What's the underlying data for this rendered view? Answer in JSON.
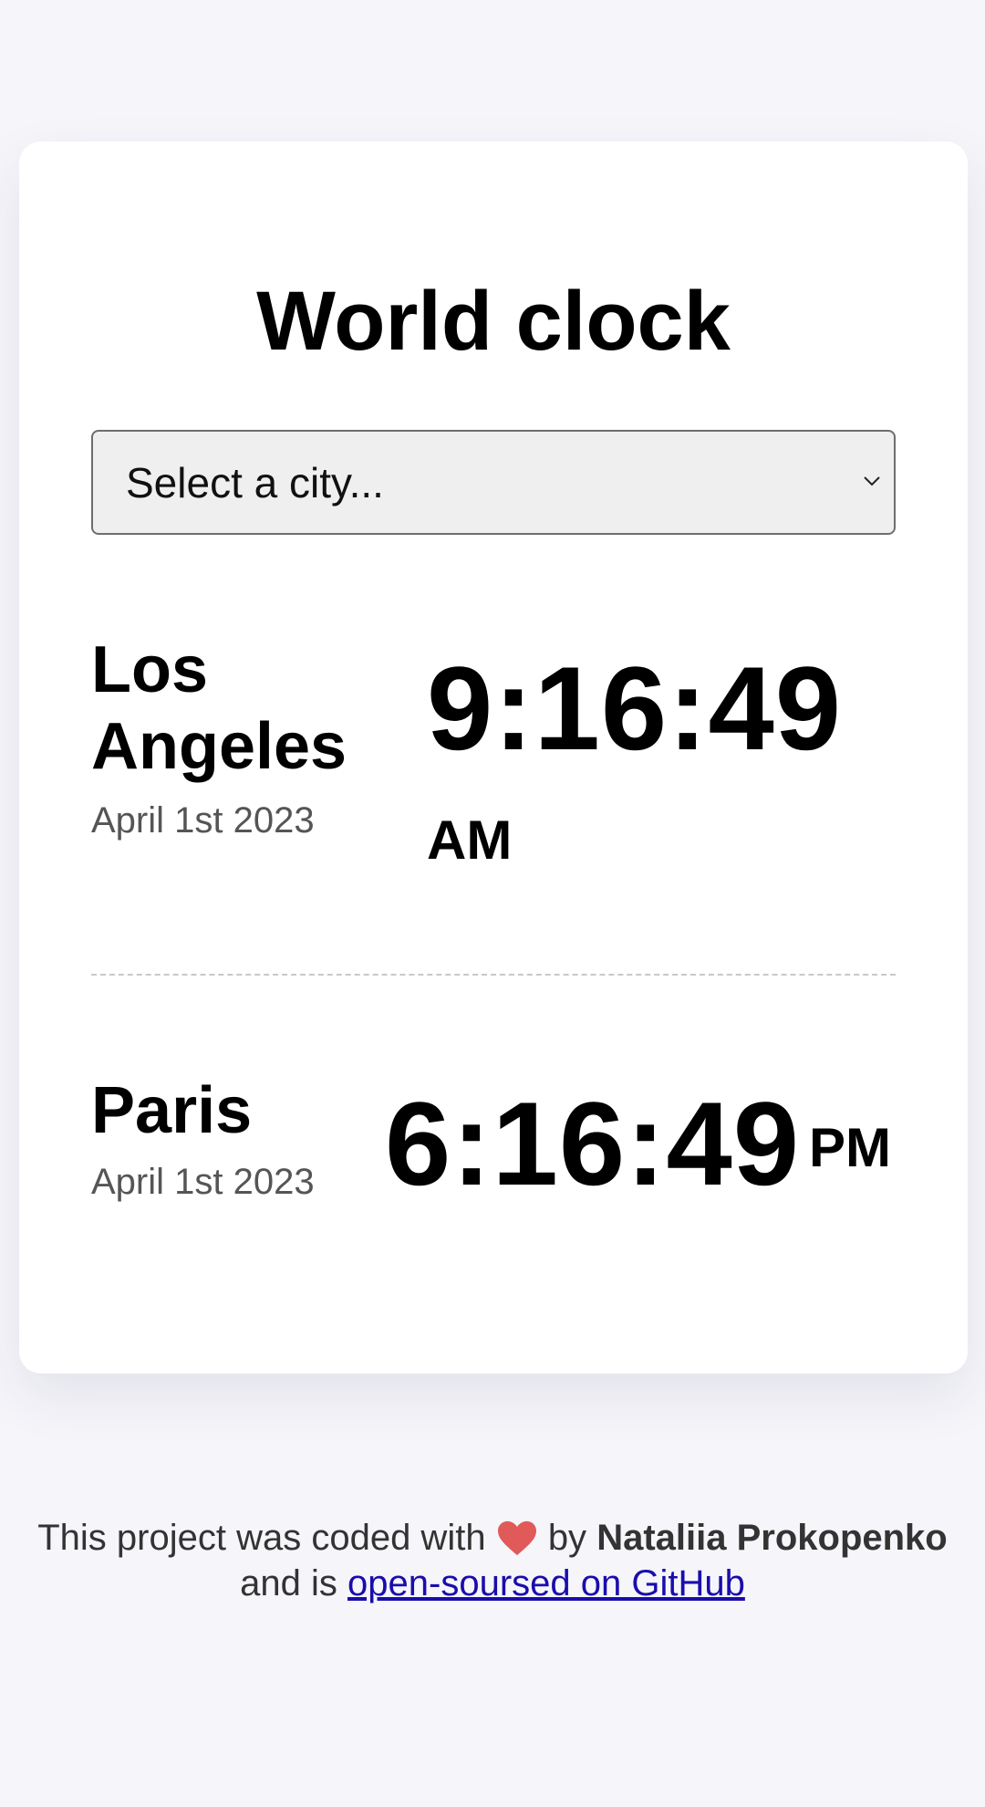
{
  "page": {
    "title": "World clock"
  },
  "city_select": {
    "value": "Select a city...",
    "icon": "chevron-down-icon"
  },
  "cities": [
    {
      "name_line1": "Los",
      "name_line2": "Angeles",
      "date": "April 1st 2023",
      "time": "9:16:49",
      "ampm": "AM"
    },
    {
      "name_line1": "Paris",
      "date": "April 1st 2023",
      "time": "6:16:49",
      "ampm": "PM"
    }
  ],
  "footer": {
    "text_before": "This project was coded with",
    "heart_icon": "heart-icon",
    "text_by": "by",
    "author": "Nataliia Prokopenko",
    "text_and": "and is",
    "link_text": "open-soursed on GitHub"
  },
  "colors": {
    "background": "#f5f5fa",
    "card": "#ffffff",
    "link": "#1a0dab",
    "heart": "#e05a5a"
  }
}
